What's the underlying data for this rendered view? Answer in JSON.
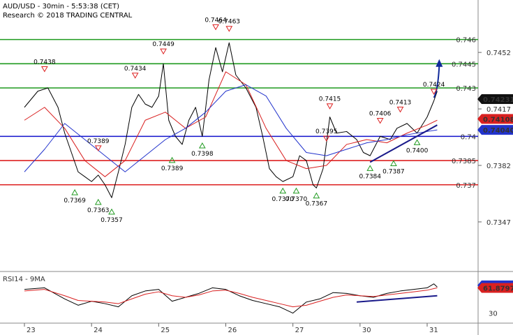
{
  "header": {
    "title": "AUD/USD - 30min - 5:53:38 (CET)",
    "research": "Research © 2018 TRADING CENTRAL"
  },
  "colors": {
    "price": "#000000",
    "ma_fast": "#d92020",
    "ma_slow": "#2233cc",
    "resistance": "#1f9a1f",
    "support": "#dd2020",
    "pivot": "#1010cc",
    "trend_line": "#1a1a8a",
    "arrow": "#102a9a"
  },
  "chart_data": [
    {
      "type": "line",
      "title": "AUD/USD - 30min - 5:53:38 (CET)",
      "x_ticks": [
        "23",
        "24",
        "25",
        "26",
        "27",
        "30",
        "31"
      ],
      "y_ticks": [
        0.7452,
        0.7417,
        0.7382,
        0.7347
      ],
      "ylim": [
        0.7318,
        0.7478
      ],
      "horizontal_levels": [
        {
          "value": 0.746,
          "label": "0.746",
          "kind": "resistance"
        },
        {
          "value": 0.7445,
          "label": "0.7445",
          "kind": "resistance"
        },
        {
          "value": 0.743,
          "label": "0.743",
          "kind": "resistance"
        },
        {
          "value": 0.74,
          "label": "0.74",
          "kind": "pivot"
        },
        {
          "value": 0.7385,
          "label": "0.7385",
          "kind": "support"
        },
        {
          "value": 0.737,
          "label": "0.737",
          "kind": "support"
        }
      ],
      "value_tags": [
        {
          "value": 0.74231,
          "label": "0.74231",
          "kind": "last"
        },
        {
          "value": 0.74108,
          "label": "0.74108",
          "kind": "ma_fast"
        },
        {
          "value": 0.7404,
          "label": "0.74040",
          "kind": "ma_slow"
        }
      ],
      "peaks": [
        {
          "x": 0.3,
          "value": 0.7438,
          "label": "0.7438"
        },
        {
          "x": 1.1,
          "value": 0.7389,
          "label": "0.7389"
        },
        {
          "x": 1.65,
          "value": 0.7434,
          "label": "0.7434"
        },
        {
          "x": 2.07,
          "value": 0.7449,
          "label": "0.7449"
        },
        {
          "x": 2.85,
          "value": 0.7464,
          "label": "0.7464"
        },
        {
          "x": 3.05,
          "value": 0.7463,
          "label": "0.7463"
        },
        {
          "x": 4.5,
          "value": 0.7395,
          "label": "0.7395"
        },
        {
          "x": 4.55,
          "value": 0.7415,
          "label": "0.7415"
        },
        {
          "x": 5.3,
          "value": 0.7406,
          "label": "0.7406"
        },
        {
          "x": 5.6,
          "value": 0.7413,
          "label": "0.7413"
        },
        {
          "x": 6.1,
          "value": 0.7424,
          "label": "0.7424"
        }
      ],
      "troughs": [
        {
          "x": 0.75,
          "value": 0.7369,
          "label": "0.7369"
        },
        {
          "x": 1.1,
          "value": 0.7363,
          "label": "0.7363"
        },
        {
          "x": 1.3,
          "value": 0.7357,
          "label": "0.7357"
        },
        {
          "x": 2.2,
          "value": 0.7389,
          "label": "0.7389"
        },
        {
          "x": 2.65,
          "value": 0.7398,
          "label": "0.7398"
        },
        {
          "x": 3.85,
          "value": 0.737,
          "label": "0.7370"
        },
        {
          "x": 4.05,
          "value": 0.737,
          "label": "0.7370"
        },
        {
          "x": 4.35,
          "value": 0.7367,
          "label": "0.7367"
        },
        {
          "x": 5.15,
          "value": 0.7384,
          "label": "0.7384"
        },
        {
          "x": 5.5,
          "value": 0.7387,
          "label": "0.7387"
        },
        {
          "x": 5.85,
          "value": 0.74,
          "label": "0.7400"
        }
      ],
      "series": [
        {
          "kind": "price",
          "x": [
            0,
            0.2,
            0.35,
            0.5,
            0.6,
            0.7,
            0.8,
            0.9,
            1.0,
            1.1,
            1.2,
            1.3,
            1.4,
            1.5,
            1.6,
            1.7,
            1.8,
            1.9,
            2.0,
            2.07,
            2.15,
            2.25,
            2.35,
            2.45,
            2.55,
            2.65,
            2.75,
            2.85,
            2.95,
            3.05,
            3.15,
            3.3,
            3.45,
            3.55,
            3.65,
            3.75,
            3.85,
            4.0,
            4.1,
            4.2,
            4.3,
            4.35,
            4.45,
            4.55,
            4.65,
            4.8,
            4.95,
            5.05,
            5.15,
            5.3,
            5.45,
            5.55,
            5.7,
            5.85,
            6.0,
            6.1,
            6.15
          ],
          "y": [
            0.7418,
            0.7428,
            0.743,
            0.7418,
            0.7402,
            0.739,
            0.7378,
            0.7375,
            0.7372,
            0.7376,
            0.737,
            0.7362,
            0.7378,
            0.7395,
            0.7418,
            0.7426,
            0.742,
            0.7418,
            0.7425,
            0.7445,
            0.741,
            0.74,
            0.7395,
            0.741,
            0.7418,
            0.74,
            0.7435,
            0.7455,
            0.744,
            0.7458,
            0.7438,
            0.743,
            0.7418,
            0.74,
            0.738,
            0.7375,
            0.7372,
            0.7375,
            0.7388,
            0.7385,
            0.737,
            0.7368,
            0.738,
            0.7412,
            0.7402,
            0.7403,
            0.7398,
            0.739,
            0.7388,
            0.74,
            0.7398,
            0.7405,
            0.7408,
            0.7402,
            0.7412,
            0.7422,
            0.7428
          ]
        },
        {
          "kind": "ma_fast",
          "x": [
            0,
            0.3,
            0.6,
            0.9,
            1.2,
            1.5,
            1.8,
            2.1,
            2.4,
            2.7,
            3.0,
            3.3,
            3.6,
            3.9,
            4.2,
            4.5,
            4.8,
            5.1,
            5.4,
            5.7,
            6.0,
            6.15
          ],
          "y": [
            0.741,
            0.7418,
            0.7405,
            0.7385,
            0.7375,
            0.7385,
            0.741,
            0.7415,
            0.7405,
            0.7412,
            0.744,
            0.7432,
            0.7405,
            0.7385,
            0.738,
            0.7382,
            0.7395,
            0.7398,
            0.7396,
            0.7402,
            0.7407,
            0.741
          ]
        },
        {
          "kind": "ma_slow",
          "x": [
            0,
            0.3,
            0.6,
            0.9,
            1.2,
            1.5,
            1.8,
            2.1,
            2.4,
            2.7,
            3.0,
            3.3,
            3.6,
            3.9,
            4.2,
            4.5,
            4.8,
            5.1,
            5.4,
            5.7,
            6.0,
            6.15
          ],
          "y": [
            0.7378,
            0.7392,
            0.7408,
            0.7398,
            0.7388,
            0.7378,
            0.7388,
            0.7398,
            0.7405,
            0.7415,
            0.7428,
            0.7432,
            0.7425,
            0.7405,
            0.739,
            0.7388,
            0.7392,
            0.7396,
            0.7398,
            0.7401,
            0.7403,
            0.7404
          ]
        }
      ],
      "trend_line": {
        "x": [
          5.15,
          6.15
        ],
        "y": [
          0.7384,
          0.7407
        ]
      },
      "arrow": {
        "x": [
          6.1,
          6.18
        ],
        "y": [
          0.7424,
          0.7447
        ]
      }
    },
    {
      "type": "line",
      "title": "RSI14 - 9MA",
      "ylim": [
        20,
        80
      ],
      "y_ticks": [
        30
      ],
      "value_tags": [
        {
          "value": 65.0875,
          "label": "65.0875",
          "kind": "rsi"
        },
        {
          "value": 61.8797,
          "label": "61.8797",
          "kind": "ma"
        }
      ],
      "series": [
        {
          "kind": "rsi",
          "x": [
            0,
            0.3,
            0.6,
            0.8,
            1.0,
            1.2,
            1.4,
            1.6,
            1.8,
            2.0,
            2.2,
            2.4,
            2.6,
            2.8,
            3.0,
            3.2,
            3.4,
            3.6,
            3.8,
            4.0,
            4.2,
            4.4,
            4.6,
            4.8,
            5.0,
            5.2,
            5.4,
            5.6,
            5.8,
            6.0,
            6.1,
            6.15
          ],
          "y": [
            60,
            62,
            48,
            40,
            45,
            42,
            38,
            52,
            58,
            60,
            45,
            50,
            55,
            62,
            60,
            52,
            46,
            42,
            38,
            30,
            44,
            48,
            56,
            55,
            52,
            50,
            55,
            58,
            60,
            62,
            67,
            63
          ]
        },
        {
          "kind": "ma",
          "x": [
            0,
            0.3,
            0.6,
            0.8,
            1.0,
            1.2,
            1.4,
            1.6,
            1.8,
            2.0,
            2.2,
            2.4,
            2.6,
            2.8,
            3.0,
            3.2,
            3.4,
            3.6,
            3.8,
            4.0,
            4.2,
            4.4,
            4.6,
            4.8,
            5.0,
            5.2,
            5.4,
            5.6,
            5.8,
            6.0,
            6.1,
            6.15
          ],
          "y": [
            58,
            60,
            52,
            46,
            45,
            44,
            42,
            48,
            54,
            57,
            52,
            50,
            53,
            58,
            59,
            55,
            50,
            46,
            42,
            38,
            40,
            45,
            50,
            53,
            52,
            51,
            53,
            55,
            57,
            59,
            61,
            62
          ]
        }
      ],
      "trend_line": {
        "x": [
          4.95,
          6.15
        ],
        "y": [
          44,
          52
        ]
      }
    }
  ]
}
